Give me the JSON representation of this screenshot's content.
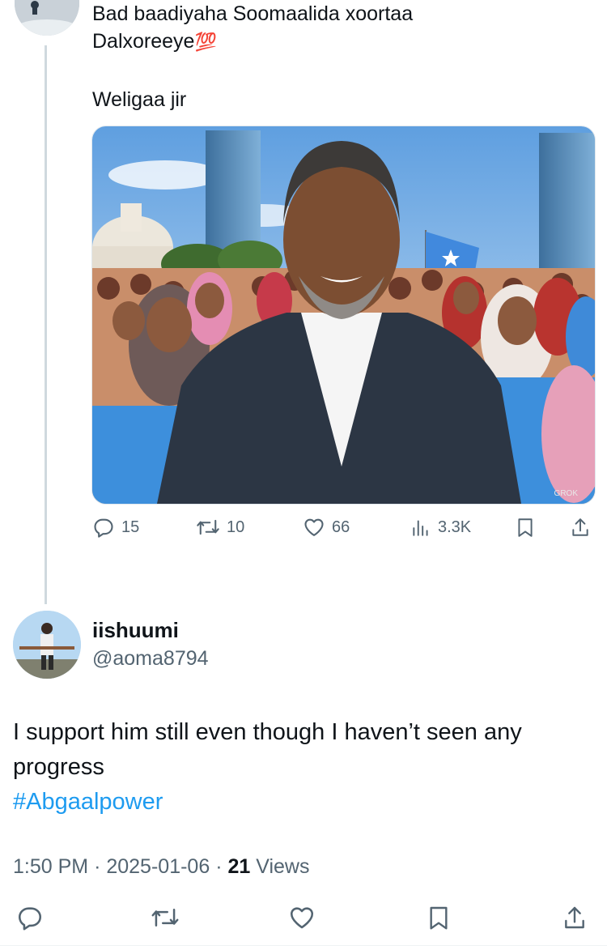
{
  "parent_tweet": {
    "line1": "Bad baadiyaha Soomaalida xoortaa",
    "line2": "Dalxoreeye",
    "emoji": "💯",
    "line3": "Weligaa jir",
    "image_watermark": "GROK",
    "actions": {
      "replies": "15",
      "retweets": "10",
      "likes": "66",
      "views": "3.3K"
    }
  },
  "reply_tweet": {
    "display_name": "iishuumi",
    "handle": "@aoma8794",
    "body_line1": "I support him still even though I haven’t seen any",
    "body_line2": "progress",
    "hashtag": "#Abgaalpower",
    "time": "1:50 PM",
    "date": "2025-01-06",
    "views_count": "21",
    "views_label": "Views",
    "separator": "·"
  },
  "colors": {
    "text": "#0f1419",
    "secondary": "#536471",
    "link": "#1d9bf0",
    "thread_line": "#cfd9de"
  }
}
